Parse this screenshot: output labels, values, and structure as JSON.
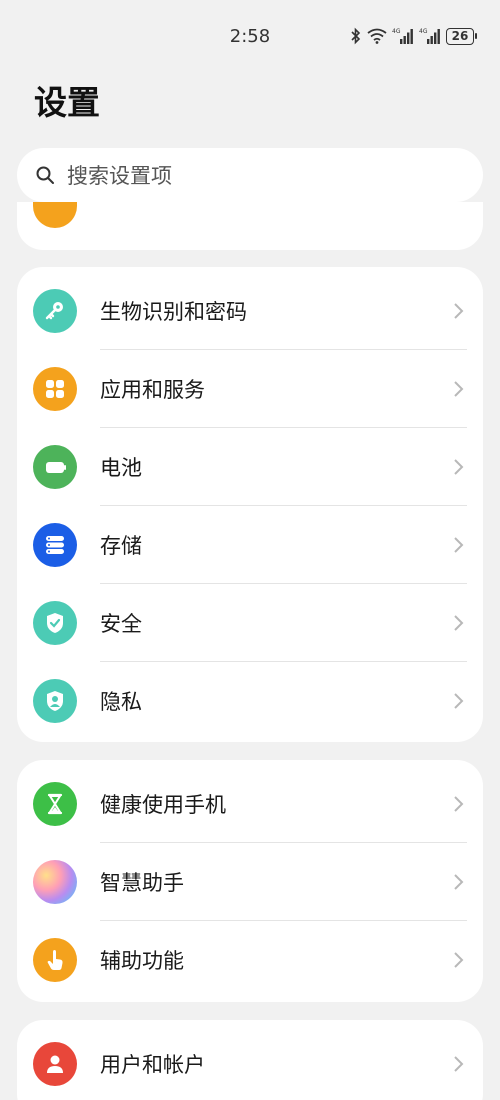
{
  "status_bar": {
    "time": "2:58",
    "battery": "26",
    "icons": [
      "bluetooth-icon",
      "wifi-icon",
      "signal-4g-icon",
      "signal-4g-icon",
      "battery-icon"
    ]
  },
  "header": {
    "title": "设置"
  },
  "search": {
    "placeholder": "搜索设置项"
  },
  "partial_item": {
    "icon": "partial-orange-icon",
    "color": "#f4a21d"
  },
  "groups": [
    {
      "items": [
        {
          "label": "生物识别和密码",
          "icon": "key-icon",
          "color": "#4ccbb5"
        },
        {
          "label": "应用和服务",
          "icon": "apps-icon",
          "color": "#f4a21d"
        },
        {
          "label": "电池",
          "icon": "battery-icon",
          "color": "#4db35a"
        },
        {
          "label": "存储",
          "icon": "storage-icon",
          "color": "#1b5ee6"
        },
        {
          "label": "安全",
          "icon": "shield-check-icon",
          "color": "#4ccbb5"
        },
        {
          "label": "隐私",
          "icon": "privacy-icon",
          "color": "#4ccbb5"
        }
      ]
    },
    {
      "items": [
        {
          "label": "健康使用手机",
          "icon": "hourglass-icon",
          "color": "#3dbf47"
        },
        {
          "label": "智慧助手",
          "icon": "assistant-icon",
          "color": "gradient"
        },
        {
          "label": "辅助功能",
          "icon": "hand-touch-icon",
          "color": "#f4a21d"
        }
      ]
    },
    {
      "items": [
        {
          "label": "用户和帐户",
          "icon": "user-icon",
          "color": "#e8473a"
        }
      ]
    }
  ]
}
